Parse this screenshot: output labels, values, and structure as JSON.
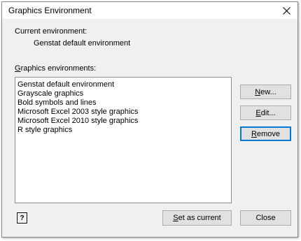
{
  "window": {
    "title": "Graphics Environment"
  },
  "current": {
    "label": "Current environment:",
    "value": "Genstat default environment"
  },
  "environments": {
    "label": "Graphics environments:",
    "items": [
      "Genstat default environment",
      "Grayscale graphics",
      "Bold symbols and lines",
      "Microsoft Excel 2003 style graphics",
      "Microsoft Excel 2010 style graphics",
      "R style graphics"
    ]
  },
  "buttons": {
    "new": "New...",
    "edit": "Edit...",
    "remove": "Remove",
    "set_current": "Set as current",
    "close": "Close",
    "help": "?"
  }
}
